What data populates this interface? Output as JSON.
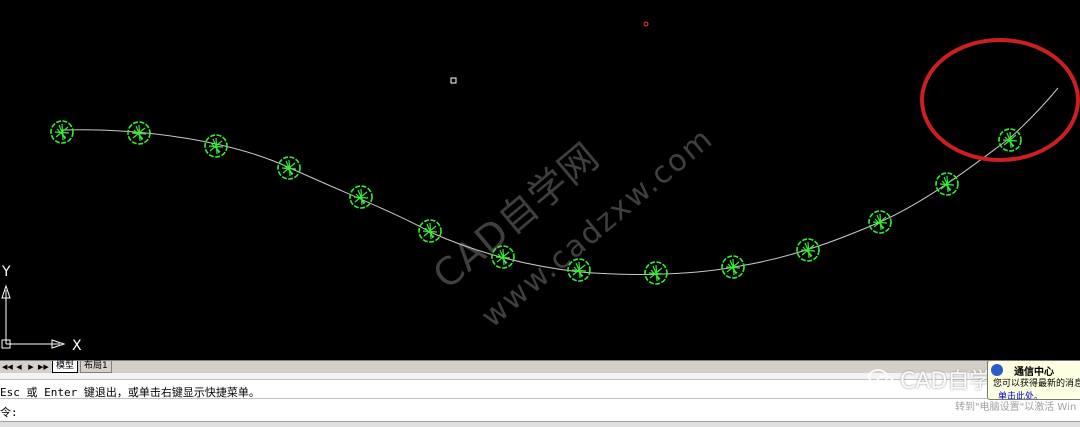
{
  "watermark": {
    "line1": "CAD自学网",
    "line2": "www.cadzxw.com"
  },
  "ucs": {
    "x_label": "X",
    "y_label": "Y"
  },
  "tabs": {
    "nav": [
      "◀◀",
      "◀",
      "▶",
      "▶▶"
    ],
    "model": "模型",
    "layout1": "布局1"
  },
  "command": {
    "history": "Esc 或 Enter 键退出，或单击右键显示快捷菜单。",
    "prompt": "令:"
  },
  "overlay": {
    "wechat_text": "CAD自学网",
    "activate_text": "转到\"电脑设置\"以激活 Win"
  },
  "notice": {
    "title": "通信中心",
    "body": "您可以获得最新的消息",
    "link": "单击此处。"
  },
  "colors": {
    "canvas_bg": "#000000",
    "curve": "#c8c8c8",
    "symbol": "#33ee33",
    "highlight_ring": "#cc1f1f",
    "marker_red": "#ff3333"
  }
}
